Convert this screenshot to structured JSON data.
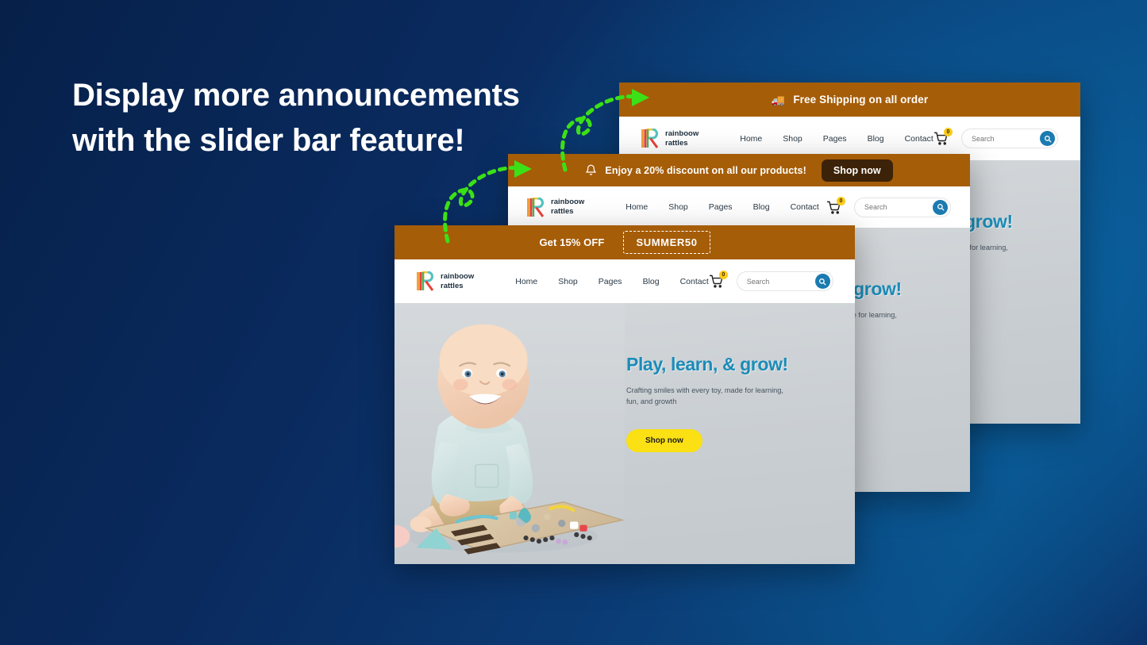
{
  "headline": "Display more announcements with the slider bar feature!",
  "theme": {
    "bg_dark": "#062049",
    "bg_light": "#0a5f9c",
    "banner_brown": "#a65d08",
    "banner_btn_dark": "#3c2208",
    "accent_yellow": "#fbe013",
    "accent_blue": "#1b8cb8",
    "arrow_green": "#3ce016",
    "hero_bg": "#cbd0d4"
  },
  "brand": {
    "name_line1": "rainboow",
    "name_line2": "rattles",
    "logo_icon": "rainbow-r-logo"
  },
  "nav": {
    "links": [
      "Home",
      "Shop",
      "Pages",
      "Blog",
      "Contact"
    ],
    "cart_icon": "shopping-cart-icon",
    "cart_count": "0",
    "search_placeholder": "Search",
    "search_value": "",
    "search_icon": "search-icon"
  },
  "hero": {
    "title": "Play, learn, & grow!",
    "subtitle": "Crafting smiles with every toy, made for learning, fun, and growth",
    "button": "Shop now",
    "image_alt": "smiling-baby-with-wooden-busy-board-toy"
  },
  "cards": [
    {
      "id": "card-back",
      "banner": {
        "icon": "delivery-truck-emoji",
        "emoji": "🚚",
        "text": "Free Shipping on all order",
        "style": "text-only"
      }
    },
    {
      "id": "card-mid",
      "banner": {
        "icon": "bell-icon",
        "text": "Enjoy a 20% discount on all our products!",
        "button": "Shop now",
        "style": "text-with-button"
      }
    },
    {
      "id": "card-front",
      "banner": {
        "text": "Get 15% OFF",
        "coupon_code": "SUMMER50",
        "style": "text-with-coupon"
      }
    }
  ],
  "arrows": [
    {
      "name": "pointer-arrow-top",
      "icon": "curved-dashed-arrow"
    },
    {
      "name": "pointer-arrow-bottom",
      "icon": "curved-dashed-arrow"
    }
  ]
}
